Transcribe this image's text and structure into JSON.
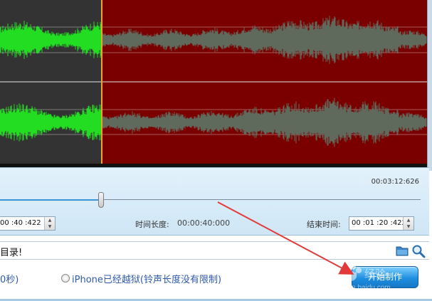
{
  "colors": {
    "selected_region_bg": "#333333",
    "waveform_selected": "#22dd22",
    "unselected_region_bg": "#7a0000",
    "waveform_unselected": "#5f6a5c",
    "selection_marker": "#f2a12b",
    "annotation_arrow": "#e23a3a",
    "accent": "#1f8fe0"
  },
  "timeline": {
    "total_duration": "00:03:12:626",
    "start_time_value": "00 :40 :422",
    "duration_label": "时间长度:",
    "duration_value": "00:00:40:000",
    "end_time_label": "结束时间:",
    "end_time_value": "00 :01 :20 :422",
    "slider_position_fraction": 0.2
  },
  "pathbar": {
    "text": "目录!",
    "folder_icon": "folder-icon",
    "search_icon": "search-icon"
  },
  "options": {
    "left_option_text": "0秒)",
    "jailbroken_option_label": "iPhone已经越狱(铃声长度没有限制)",
    "start_button_label": "开始制作"
  },
  "watermark": {
    "brand": "Baidu",
    "brand_cn": "经验",
    "domain": "jingyan.baidu.com"
  }
}
